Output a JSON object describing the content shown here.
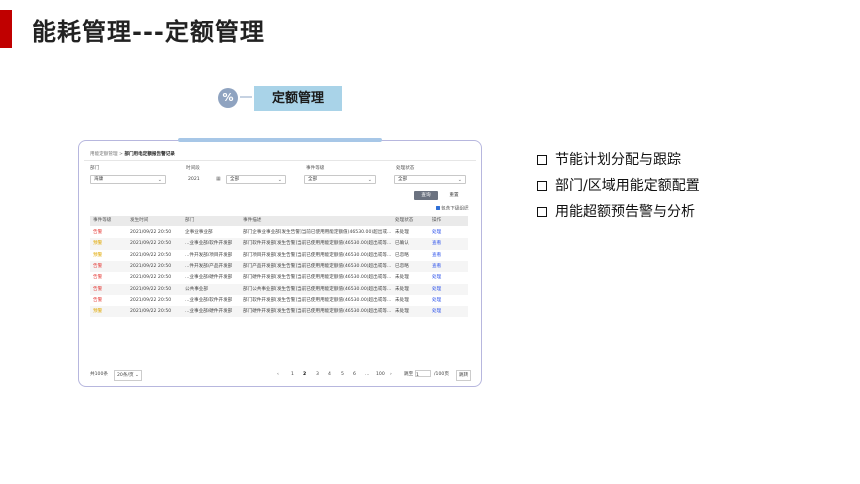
{
  "slide": {
    "title": "能耗管理---定额管理",
    "section_icon": "%",
    "section_label": "定额管理"
  },
  "screen": {
    "breadcrumb_parent": "用能定额管理 >",
    "breadcrumb_current": "部门用电定额报告警记录",
    "filters": {
      "dept_label": "部门",
      "dept_value": "海康",
      "time_label": "时间段",
      "time_year": "2021",
      "time_value": "全部",
      "level_label": "事件等级",
      "level_value": "全部",
      "status_label": "处理状态",
      "status_value": "全部"
    },
    "query_button": "查询",
    "reset_button": "重置",
    "include_sub_label": "包含下级组织",
    "table": {
      "headers": [
        "事件等级",
        "发生时间",
        "部门",
        "事件描述",
        "处理状态",
        "操作"
      ],
      "rows": [
        {
          "level": "告警",
          "level_color": "#e53935",
          "time": "2021/09/22 20:50",
          "dept": "企事业事业部",
          "desc": "部门企事业事业部[发生告警]当前已使用用能定额值(46530.00)超出或...",
          "status": "未处理",
          "action": "处理"
        },
        {
          "level": "预警",
          "level_color": "#e0a800",
          "time": "2021/09/22 20:50",
          "dept": "...业事业部/软件开发部",
          "desc": "部门软件开发部[发生告警]当前已使用用能定额值(46530.00)超出或等...",
          "status": "已确认",
          "action": "查看"
        },
        {
          "level": "预警",
          "level_color": "#e0a800",
          "time": "2021/09/22 20:50",
          "dept": "...件开发部/项目开发部",
          "desc": "部门项目开发部[发生告警]当前已使用用能定额值(46530.00)超出或等...",
          "status": "已忽略",
          "action": "查看"
        },
        {
          "level": "告警",
          "level_color": "#e53935",
          "time": "2021/09/22 20:50",
          "dept": "...件开发部/产品开发部",
          "desc": "部门产品开发部[发生告警]当前已使用用能定额值(46530.00)超出或等...",
          "status": "已忽略",
          "action": "查看"
        },
        {
          "level": "告警",
          "level_color": "#e53935",
          "time": "2021/09/22 20:50",
          "dept": "...业事业部/硬件开发部",
          "desc": "部门硬件开发部[发生告警]当前已使用用能定额值(46530.00)超出或等...",
          "status": "未处理",
          "action": "处理"
        },
        {
          "level": "告警",
          "level_color": "#e53935",
          "time": "2021/09/22 20:50",
          "dept": "公共事业部",
          "desc": "部门公共事业部[发生告警]当前已使用用能定额值(46530.00)超出或等...",
          "status": "未处理",
          "action": "处理"
        },
        {
          "level": "告警",
          "level_color": "#e53935",
          "time": "2021/09/22 20:50",
          "dept": "...业事业部/软件开发部",
          "desc": "部门软件开发部[发生告警]当前已使用用能定额值(46530.00)超出或等...",
          "status": "未处理",
          "action": "处理"
        },
        {
          "level": "预警",
          "level_color": "#e0a800",
          "time": "2021/09/22 20:50",
          "dept": "...业事业部/硬件开发部",
          "desc": "部门硬件开发部[发生告警]当前已使用用能定额值(46530.00)超出或等...",
          "status": "未处理",
          "action": "处理"
        }
      ]
    },
    "pagination": {
      "total": "共100条",
      "page_size": "20条/页",
      "prev": "‹",
      "pages": [
        "1",
        "2",
        "3",
        "4",
        "5",
        "6",
        "...",
        "100"
      ],
      "current_page": "2",
      "next": "›",
      "goto_label": "跳至",
      "goto_value": "1",
      "total_pages": "/100页",
      "go_button": "跳转"
    }
  },
  "bullets": [
    "节能计划分配与跟踪",
    "部门/区域用能定额配置",
    "用能超额预告警与分析"
  ]
}
